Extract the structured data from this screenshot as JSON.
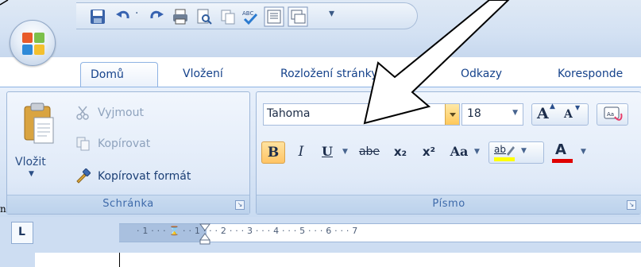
{
  "window": {
    "quick_access_dropdown": "▾"
  },
  "tabs": [
    {
      "label": "Domů",
      "active": true
    },
    {
      "label": "Vložení",
      "active": false
    },
    {
      "label": "Rozložení stránky",
      "active": false
    },
    {
      "label": "Odkazy",
      "active": false
    },
    {
      "label": "Koresponde",
      "active": false
    }
  ],
  "clipboard": {
    "paste_label": "Vložit",
    "paste_arrow": "▼",
    "cut_label": "Vyjmout",
    "copy_label": "Kopírovat",
    "format_painter_label": "Kopírovat formát",
    "group_label": "Schránka",
    "launcher": "↘"
  },
  "font": {
    "font_name": "Tahoma",
    "font_size": "18",
    "grow_label": "A",
    "shrink_label": "A",
    "bold_label": "B",
    "italic_label": "I",
    "underline_label": "U",
    "strike_label": "abe",
    "subscript_label": "x₂",
    "superscript_label": "x²",
    "change_case_label": "Aa",
    "highlight_label": "ab",
    "font_color_label": "A",
    "group_label": "Písmo",
    "launcher": "↘"
  },
  "ruler": {
    "corner_label": "L",
    "ticks": "·  1  ·  ·  ·  ⌛ ·  ·  1  ·  ·  ·  2  ·  ·  ·  3  ·  ·  ·  4  ·  ·  ·  5  ·  ·  ·  6  ·  ·  ·  7"
  },
  "side_label": "n",
  "colors": {
    "accent": "#15428b",
    "highlight_yellow": "#ffff00",
    "font_color_red": "#e00000"
  }
}
